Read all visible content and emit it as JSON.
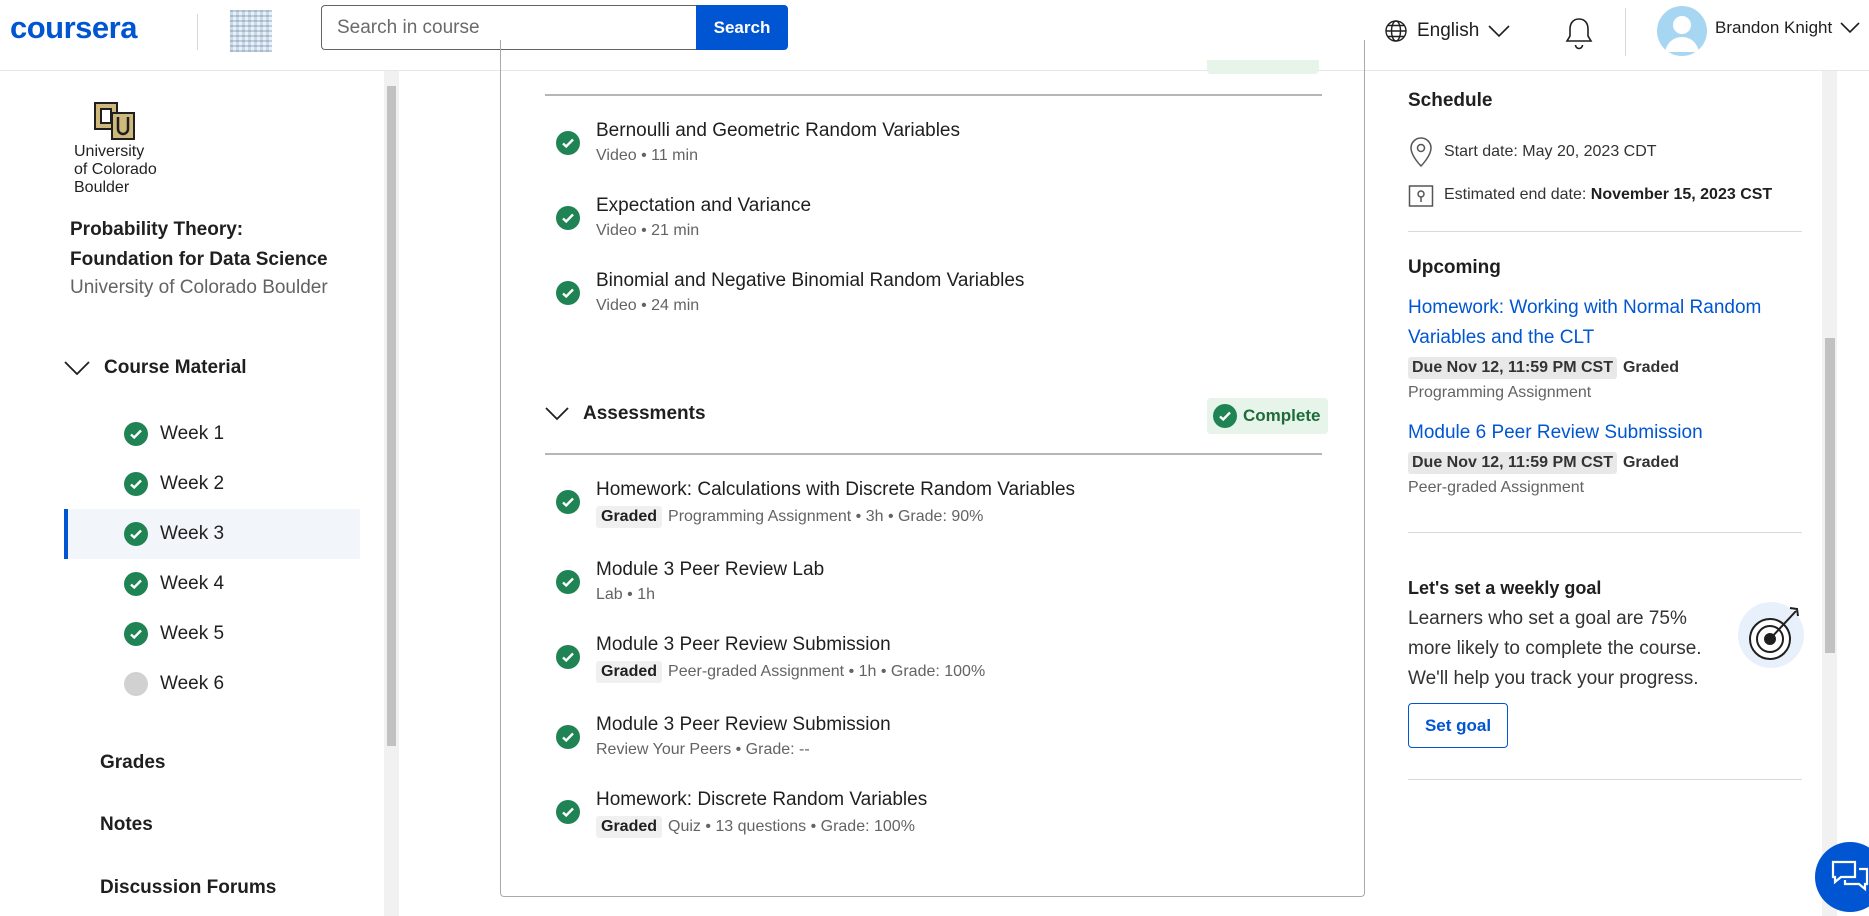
{
  "header": {
    "logo": "coursera",
    "search_placeholder": "Search in course",
    "search_button": "Search",
    "language": "English",
    "user_name": "Brandon Knight"
  },
  "sidebar": {
    "university_logo_text": [
      "University",
      "of Colorado",
      "Boulder"
    ],
    "course_title": "Probability Theory: Foundation for Data Science",
    "course_org": "University of Colorado Boulder",
    "course_material_label": "Course Material",
    "weeks": [
      {
        "label": "Week 1",
        "status": "complete"
      },
      {
        "label": "Week 2",
        "status": "complete"
      },
      {
        "label": "Week 3",
        "status": "complete",
        "active": true
      },
      {
        "label": "Week 4",
        "status": "complete"
      },
      {
        "label": "Week 5",
        "status": "complete"
      },
      {
        "label": "Week 6",
        "status": "incomplete"
      }
    ],
    "links": [
      "Grades",
      "Notes",
      "Discussion Forums"
    ]
  },
  "main": {
    "videos": [
      {
        "title": "Bernoulli and Geometric Random Variables",
        "meta": "Video • 11 min"
      },
      {
        "title": "Expectation and Variance",
        "meta": "Video • 21 min"
      },
      {
        "title": "Binomial and Negative Binomial Random Variables",
        "meta": "Video • 24 min"
      }
    ],
    "assessments_label": "Assessments",
    "complete_label": "Complete",
    "graded_label": "Graded",
    "assessments": [
      {
        "title": "Homework:  Calculations with Discrete Random Variables",
        "graded": true,
        "meta": "Programming Assignment • 3h • Grade: 90%"
      },
      {
        "title": "Module 3 Peer Review Lab",
        "graded": false,
        "meta": "Lab • 1h"
      },
      {
        "title": "Module 3 Peer Review Submission",
        "graded": true,
        "meta": "Peer-graded Assignment • 1h • Grade: 100%"
      },
      {
        "title": "Module 3 Peer Review Submission",
        "graded": false,
        "meta": "Review Your Peers • Grade: --"
      },
      {
        "title": "Homework: Discrete Random Variables",
        "graded": true,
        "meta": "Quiz • 13 questions • Grade: 100%"
      }
    ]
  },
  "right_panel": {
    "schedule_title": "Schedule",
    "start_label": "Start date: May 20, 2023 CDT",
    "end_prefix": "Estimated end date: ",
    "end_value": "November 15, 2023 CST",
    "upcoming_title": "Upcoming",
    "upcoming": [
      {
        "title": "Homework: Working with Normal Random Variables and the CLT",
        "due": "Due Nov 12, 11:59 PM CST",
        "graded": "Graded",
        "type": "Programming Assignment"
      },
      {
        "title": "Module 6 Peer Review Submission",
        "due": "Due Nov 12, 11:59 PM CST",
        "graded": "Graded",
        "type": "Peer-graded Assignment"
      }
    ],
    "goal_title": "Let's set a weekly goal",
    "goal_body": "Learners who set a goal are 75% more likely to complete the course. We'll help you track your progress.",
    "goal_button": "Set goal"
  },
  "colors": {
    "brand": "#0056d2",
    "complete": "#1f8354"
  }
}
